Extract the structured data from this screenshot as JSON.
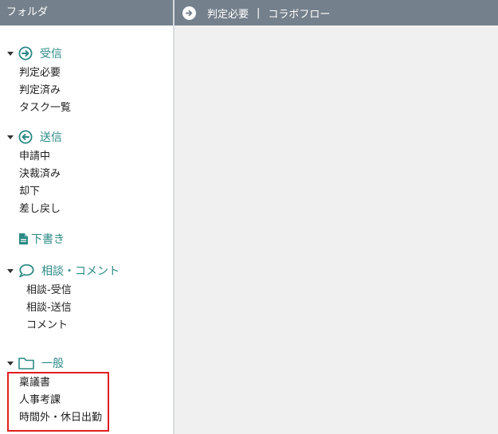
{
  "sidebar": {
    "title": "フォルダ",
    "sections": {
      "inbox": {
        "label": "受信",
        "items": [
          "判定必要",
          "判定済み",
          "タスク一覧"
        ]
      },
      "sent": {
        "label": "送信",
        "items": [
          "申請中",
          "決裁済み",
          "却下",
          "差し戻し"
        ]
      },
      "draft": {
        "label": "下書き"
      },
      "consult": {
        "label": "相談・コメント",
        "items": [
          "相談-受信",
          "相談-送信",
          "コメント"
        ]
      },
      "general": {
        "label": "一般",
        "items": [
          "稟議書",
          "人事考課",
          "時間外・休日出勤"
        ]
      }
    }
  },
  "main": {
    "header": {
      "title": "判定必要",
      "separator": "|",
      "app_name": "コラボフロー"
    }
  },
  "colors": {
    "header_bg": "#74808b",
    "accent": "#2c8a86",
    "highlight": "#e01e1e",
    "main_bg": "#f0f0f0"
  },
  "icons": {
    "inbox": "arrow-circle-right-icon",
    "sent": "arrow-circle-left-icon",
    "draft": "document-icon",
    "consult": "speech-bubble-icon",
    "general": "folder-icon",
    "header": "arrow-right-icon"
  }
}
